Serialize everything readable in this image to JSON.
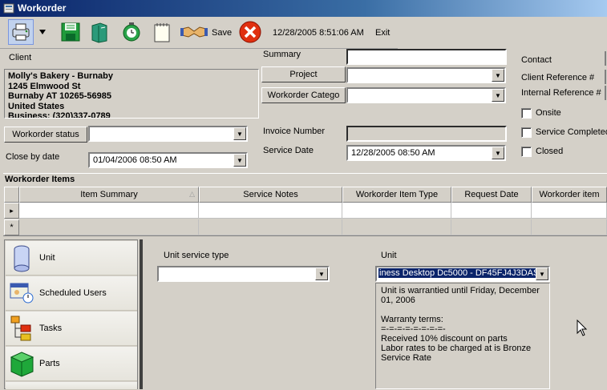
{
  "window": {
    "title": "Workorder"
  },
  "toolbar": {
    "save_label": "Save",
    "timestamp": "12/28/2005 8:51:06 AM",
    "exit_label": "Exit"
  },
  "client": {
    "label": "Client",
    "lines": [
      "Molly's Bakery - Burnaby",
      "1245 Elmwood St",
      "Burnaby AT 10265-56985",
      "United States",
      "Business: (320)337-0789"
    ]
  },
  "summary": {
    "label": "Summary",
    "value": ""
  },
  "project": {
    "button": "Project",
    "value": ""
  },
  "category": {
    "button": "Workorder Catego",
    "value": ""
  },
  "contact": {
    "label": "Contact"
  },
  "client_ref": {
    "label": "Client Reference #"
  },
  "internal_ref": {
    "label": "Internal Reference #"
  },
  "checkboxes": {
    "onsite": "Onsite",
    "service_completed": "Service Completed",
    "closed": "Closed"
  },
  "status": {
    "button": "Workorder status",
    "value": ""
  },
  "invoice": {
    "label": "Invoice Number",
    "value": ""
  },
  "close_by": {
    "label": "Close by date",
    "value": "01/04/2006 08:50 AM"
  },
  "service_date": {
    "label": "Service Date",
    "value": "12/28/2005 08:50 AM"
  },
  "items": {
    "title": "Workorder Items",
    "columns": [
      "Item Summary",
      "Service Notes",
      "Workorder Item Type",
      "Request Date",
      "Workorder item"
    ],
    "new_row_marker": "*",
    "current_row_marker": "▸"
  },
  "nav": [
    {
      "label": "Unit",
      "icon": "unit-icon"
    },
    {
      "label": "Scheduled Users",
      "icon": "scheduled-users-icon"
    },
    {
      "label": "Tasks",
      "icon": "tasks-icon"
    },
    {
      "label": "Parts",
      "icon": "parts-icon"
    }
  ],
  "unit_service_type": {
    "label": "Unit service type",
    "value": ""
  },
  "unit": {
    "label": "Unit",
    "value": "iness Desktop Dc5000 - DF45FJ4J3DAS",
    "notes": "Unit is warrantied until Friday, December 01, 2006\n\nWarranty terms:\n=-=-=-=-=-=-=-=-\nReceived 10% discount on parts\nLabor rates to be charged at is Bronze Service Rate"
  },
  "colors": {
    "title_start": "#0a246a",
    "title_end": "#a6caf0",
    "selection": "#0a246a",
    "face": "#d4d0c8"
  }
}
